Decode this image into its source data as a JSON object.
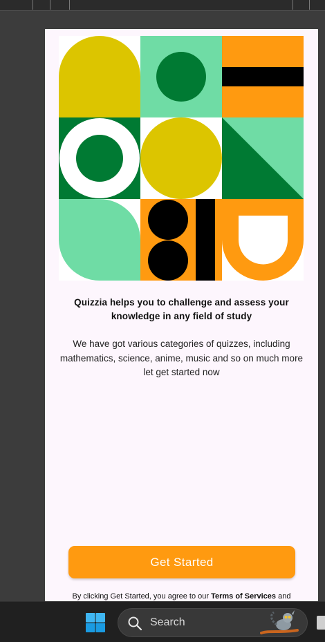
{
  "app": {
    "headline": "Quizzia helps you to challenge and assess your knowledge in any field of study",
    "description": "We have got various categories of quizzes, including mathematics, science, anime, music and so on much more let get started now",
    "cta_label": "Get Started",
    "terms": {
      "prefix": "By clicking Get Started, you agree to our ",
      "link": "Terms of Services",
      "suffix": " and"
    },
    "colors": {
      "accent": "#ff9a10",
      "yellow": "#dcc500",
      "dark_green": "#007a33",
      "mint": "#6fdca5",
      "black": "#000000",
      "white": "#ffffff"
    }
  },
  "taskbar": {
    "start_icon": "windows-logo-icon",
    "search_label": "Search",
    "search_icon": "search-icon",
    "search_art": "lemur-illustration"
  }
}
